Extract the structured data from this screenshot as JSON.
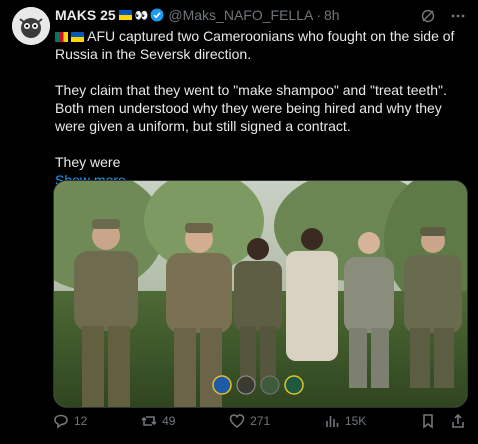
{
  "author": {
    "name": "MAKS 25",
    "eyes_emoji": "👀",
    "handle": "@Maks_NAFO_FELLA",
    "time": "8h"
  },
  "tweet": {
    "line1": "AFU captured two Cameroonians who fought on the side of Russia in the Seversk direction.",
    "line2": "They claim that they went to \"make shampoo\" and \"treat teeth\". Both men understood why they were being hired and why they were given a uniform, but still signed a contract.",
    "line3": "They were",
    "show_more": "Show more"
  },
  "actions": {
    "replies": "12",
    "reposts": "49",
    "likes": "271",
    "views": "15K"
  },
  "icons": [
    "grok-icon",
    "more-icon",
    "reply-icon",
    "repost-icon",
    "like-icon",
    "views-icon",
    "bookmark-icon",
    "share-icon"
  ],
  "colors": {
    "accent": "#1d9bf0",
    "muted": "#71767b",
    "text": "#e7e9ea",
    "background": "#000000"
  }
}
